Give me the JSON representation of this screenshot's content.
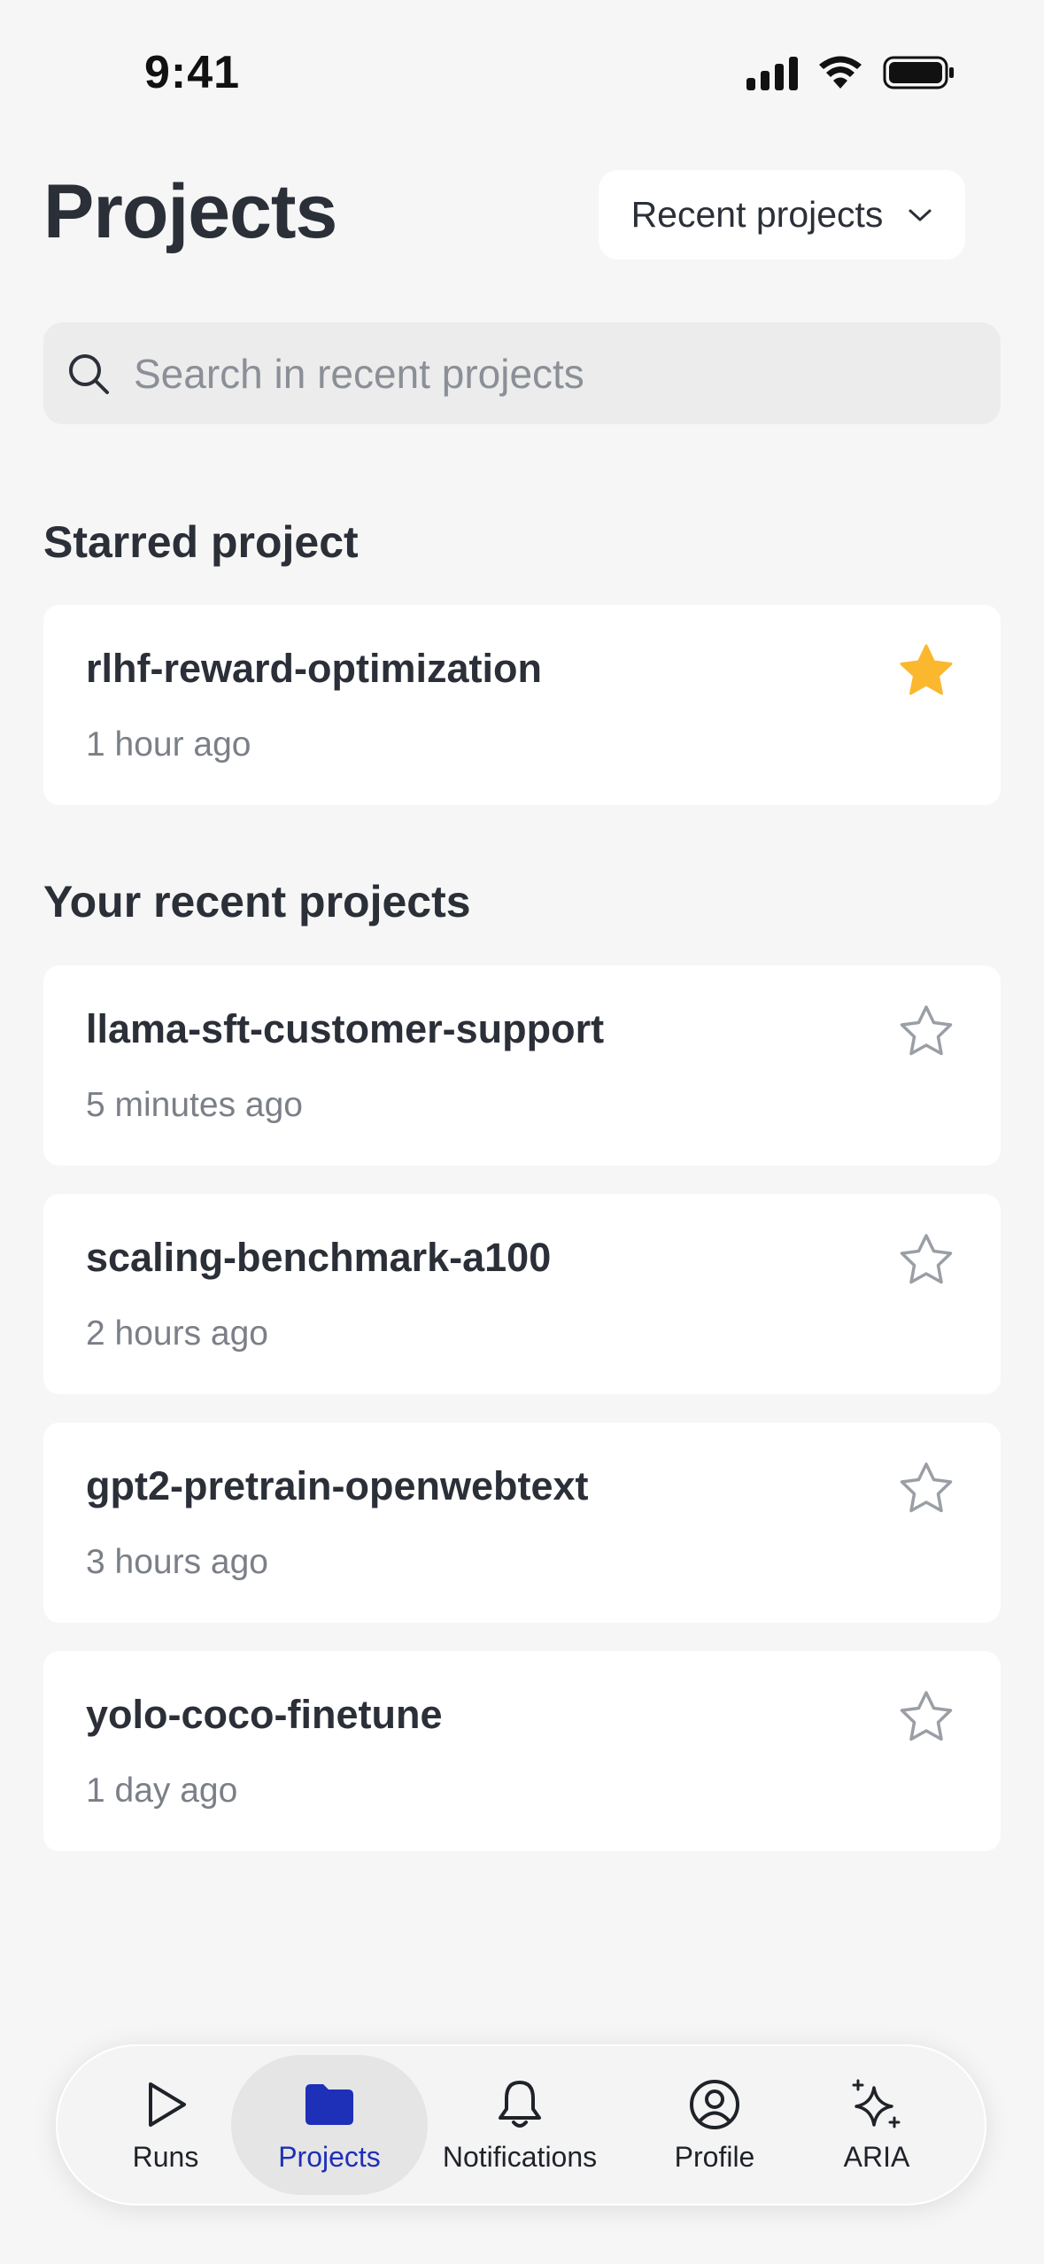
{
  "status_bar": {
    "time": "9:41"
  },
  "header": {
    "title": "Projects",
    "sort_label": "Recent projects"
  },
  "search": {
    "placeholder": "Search in recent projects",
    "value": ""
  },
  "starred": {
    "heading": "Starred project",
    "items": [
      {
        "name": "rlhf-reward-optimization",
        "time": "1 hour ago"
      }
    ]
  },
  "recent": {
    "heading": "Your recent projects",
    "items": [
      {
        "name": "llama-sft-customer-support",
        "time": "5 minutes ago"
      },
      {
        "name": "scaling-benchmark-a100",
        "time": "2 hours ago"
      },
      {
        "name": "gpt2-pretrain-openwebtext",
        "time": "3 hours ago"
      },
      {
        "name": "yolo-coco-finetune",
        "time": "1 day ago"
      }
    ]
  },
  "nav": {
    "tabs": [
      {
        "label": "Runs",
        "icon": "play-icon"
      },
      {
        "label": "Projects",
        "icon": "folder-icon",
        "active": true
      },
      {
        "label": "Notifications",
        "icon": "bell-icon"
      },
      {
        "label": "Profile",
        "icon": "profile-icon"
      },
      {
        "label": "ARIA",
        "icon": "sparkle-icon"
      }
    ]
  },
  "colors": {
    "accent": "#1e2fb8",
    "star_filled": "#fbb82e",
    "star_outline": "#9a9ea5",
    "background": "#f6f6f6"
  }
}
